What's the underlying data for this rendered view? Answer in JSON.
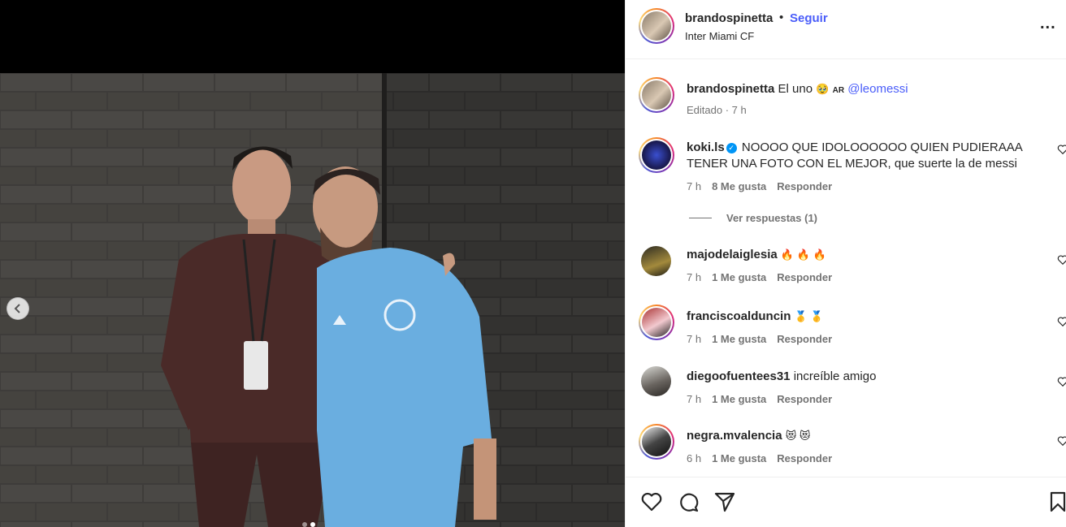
{
  "post": {
    "username": "brandospinetta",
    "separator": "•",
    "follow_label": "Seguir",
    "location": "Inter Miami CF",
    "more_label": "..."
  },
  "caption": {
    "username": "brandospinetta",
    "text_before": "El uno",
    "emoji": "🥹",
    "flag_code": "AR",
    "mention": "@leomessi",
    "meta": "Editado · 7 h"
  },
  "comments": [
    {
      "username": "koki.ls",
      "verified": true,
      "text": "NOOOO QUE IDOLOOOOOO QUIEN PUDIERAAA TENER UNA FOTO CON EL MEJOR, que suerte la de messi",
      "time": "7 h",
      "likes": "8 Me gusta",
      "reply": "Responder",
      "view_replies": "Ver respuestas (1)"
    },
    {
      "username": "majodelaiglesia",
      "text": "🔥 🔥 🔥",
      "time": "7 h",
      "likes": "1 Me gusta",
      "reply": "Responder"
    },
    {
      "username": "franciscoalduncin",
      "text": "🥇 🥇",
      "time": "7 h",
      "likes": "1 Me gusta",
      "reply": "Responder"
    },
    {
      "username": "diegoofuentees31",
      "text": "increíble amigo",
      "time": "7 h",
      "likes": "1 Me gusta",
      "reply": "Responder"
    },
    {
      "username": "negra.mvalencia",
      "text": "😻 😻",
      "time": "6 h",
      "likes": "1 Me gusta",
      "reply": "Responder"
    }
  ],
  "carousel": {
    "total": 2,
    "active": 2
  },
  "colors": {
    "link": "#4a5df9",
    "muted": "#737373",
    "text": "#262626",
    "verified": "#0095f6"
  }
}
